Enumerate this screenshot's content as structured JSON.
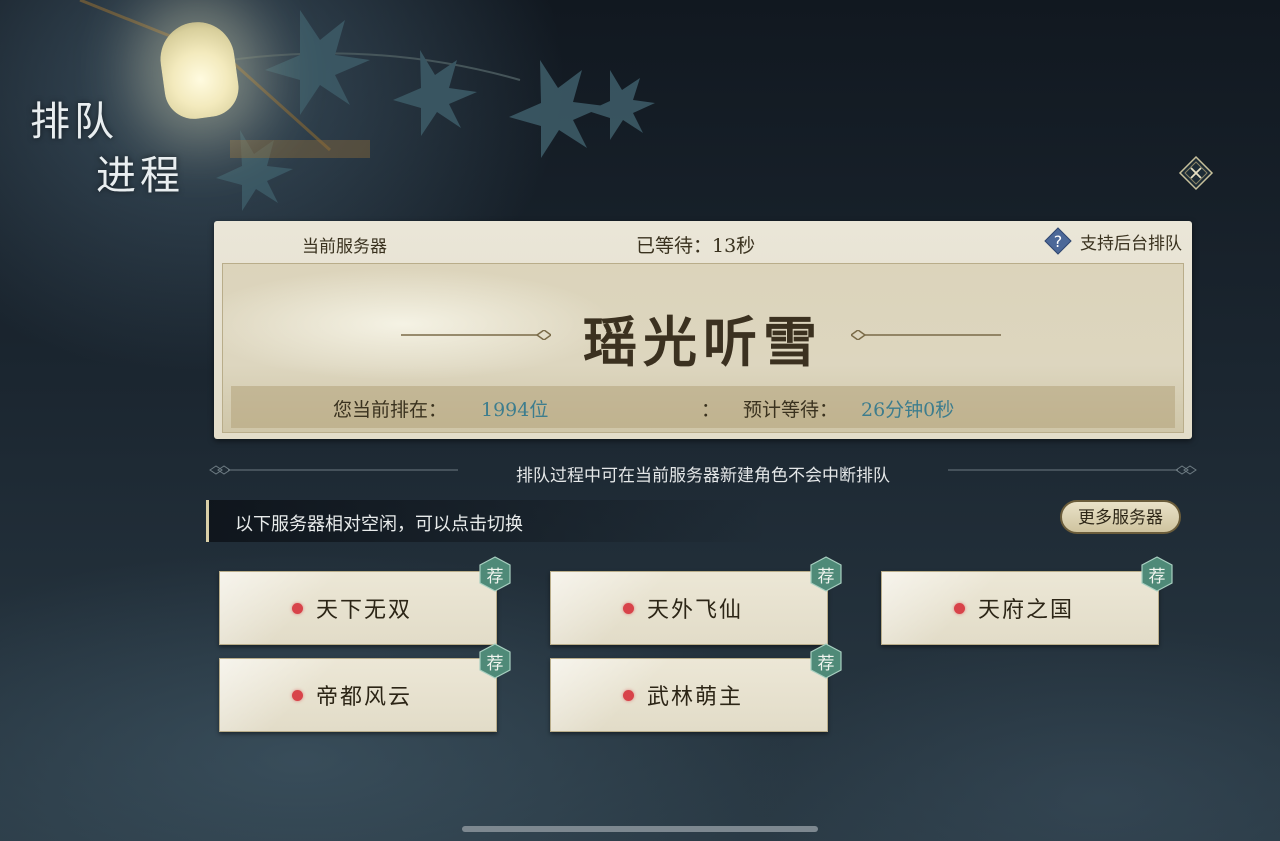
{
  "header": {
    "title_line1": "排队",
    "title_line2": "进程"
  },
  "panel": {
    "server_label": "当前服务器",
    "waited_text": "已等待：13秒",
    "support_label": "支持后台排队",
    "server_name": "瑶光听雪",
    "position_label": "您当前排在：",
    "position_value": "1994位",
    "separator": "：",
    "eta_label": "预计等待：",
    "eta_value": "26分钟0秒"
  },
  "note": "排队过程中可在当前服务器新建角色不会中断排队",
  "idle_hint": "以下服务器相对空闲，可以点击切换",
  "more_servers_label": "更多服务器",
  "servers": [
    {
      "name": "天下无双",
      "badge": "荐"
    },
    {
      "name": "天外飞仙",
      "badge": "荐"
    },
    {
      "name": "天府之国",
      "badge": "荐"
    },
    {
      "name": "帝都风云",
      "badge": "荐"
    },
    {
      "name": "武林萌主",
      "badge": "荐"
    }
  ],
  "colors": {
    "accent_teal": "#3d7d8e",
    "status_dot": "#d8434a",
    "badge_green": "#4f8a78"
  }
}
